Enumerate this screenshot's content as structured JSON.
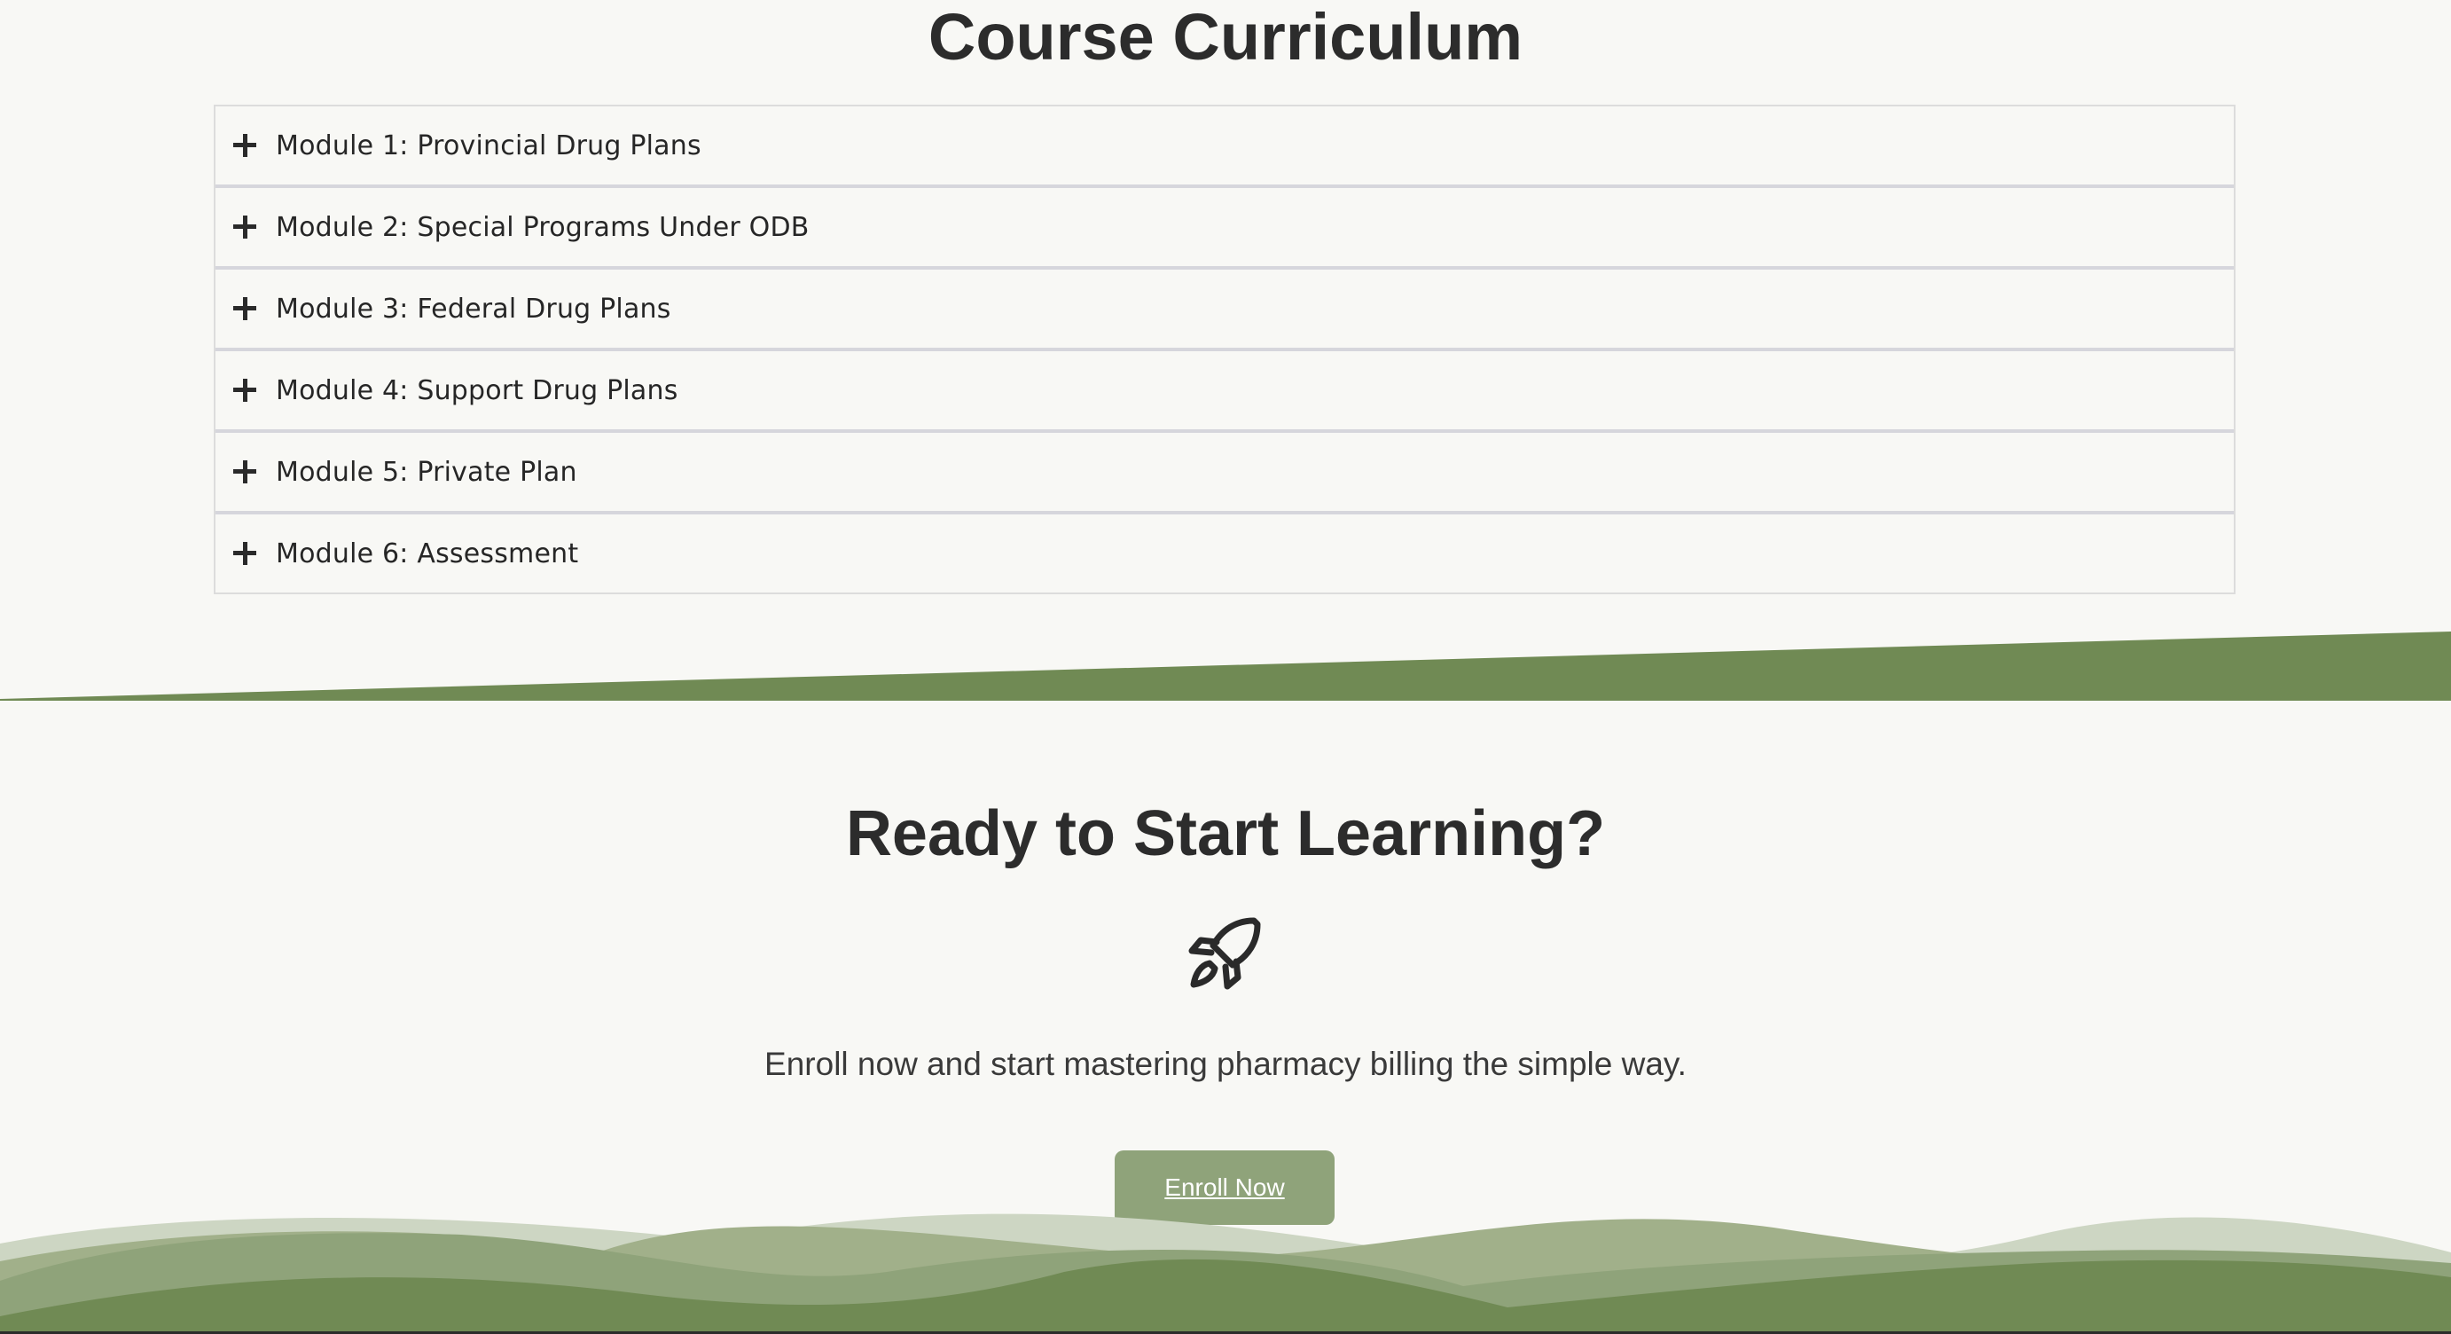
{
  "curriculum": {
    "title": "Course Curriculum",
    "modules": [
      {
        "label": "Module 1: Provincial Drug Plans"
      },
      {
        "label": "Module 2: Special Programs Under ODB"
      },
      {
        "label": "Module 3: Federal Drug Plans"
      },
      {
        "label": "Module 4: Support Drug Plans"
      },
      {
        "label": "Module 5: Private Plan"
      },
      {
        "label": "Module 6: Assessment"
      }
    ],
    "expand_icon": "plus-icon"
  },
  "cta": {
    "title": "Ready to Start Learning?",
    "icon": "rocket-icon",
    "text": "Enroll now and start mastering pharmacy billing the simple way.",
    "button_label": "Enroll Now"
  },
  "colors": {
    "background": "#f8f8f5",
    "accent_green": "#708a54",
    "button_green": "#8fa37a",
    "wave_light": "#cdd6c3",
    "wave_mid": "#a1b08a",
    "text_dark": "#2c2c2c"
  }
}
